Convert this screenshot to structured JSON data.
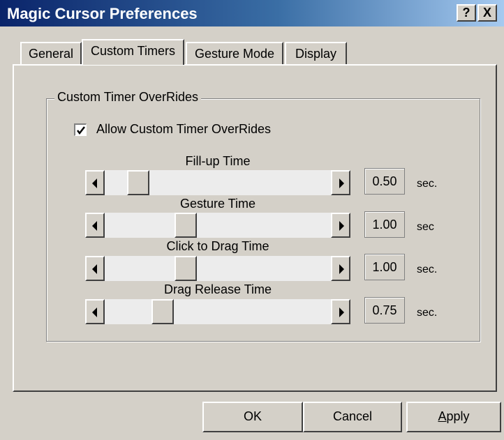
{
  "window": {
    "title": "Magic Cursor Preferences",
    "help_button": "?",
    "close_button": "X"
  },
  "tabs": [
    {
      "label": "General"
    },
    {
      "label": "Custom Timers"
    },
    {
      "label": "Gesture Mode"
    },
    {
      "label": "Display"
    }
  ],
  "active_tab": "Custom Timers",
  "group": {
    "label": "Custom Timer OverRides",
    "checkbox": {
      "label": "Allow Custom Timer OverRides",
      "checked": true
    }
  },
  "sliders": [
    {
      "label": "Fill-up Time",
      "value": "0.50",
      "unit": "sec."
    },
    {
      "label": "Gesture Time",
      "value": "1.00",
      "unit": "sec"
    },
    {
      "label": "Click to Drag Time",
      "value": "1.00",
      "unit": "sec."
    },
    {
      "label": "Drag Release Time",
      "value": "0.75",
      "unit": "sec."
    }
  ],
  "buttons": {
    "ok": "OK",
    "cancel": "Cancel",
    "apply_first": "A",
    "apply_rest": "pply"
  },
  "icons": {
    "checkmark": "checkmark-icon",
    "left_arrow": "left-arrow-icon",
    "right_arrow": "right-arrow-icon"
  },
  "colors": {
    "title_gradient_start": "#0a246a",
    "title_gradient_end": "#a6caf0",
    "face": "#d4d0c8"
  }
}
